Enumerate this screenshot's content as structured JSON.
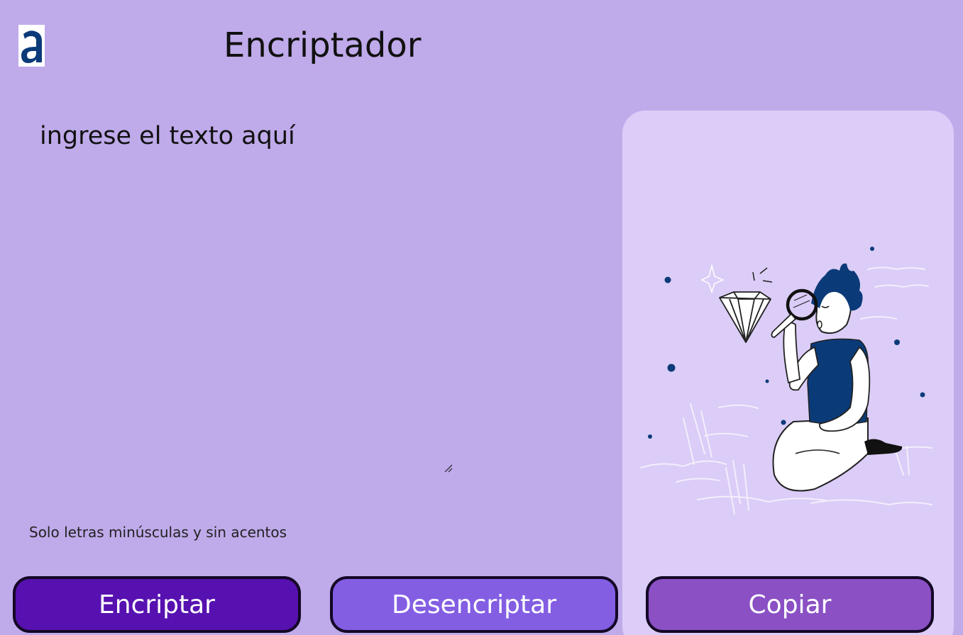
{
  "header": {
    "logo_icon": "alura-logo-icon",
    "title": "Encriptador"
  },
  "input": {
    "placeholder": "ingrese el texto aquí",
    "value": ""
  },
  "hint": "Solo letras minúsculas y sin acentos",
  "output": {
    "illustration": "person-examining-diamond-illustration"
  },
  "buttons": {
    "encrypt": "Encriptar",
    "decrypt": "Desencriptar",
    "copy": "Copiar"
  },
  "colors": {
    "background": "#bfaaea",
    "panel": "#dbcdf7",
    "encrypt_button": "#5711b0",
    "decrypt_button": "#835ee3",
    "copy_button": "#8a50c4",
    "accent_navy": "#0b3a78"
  }
}
